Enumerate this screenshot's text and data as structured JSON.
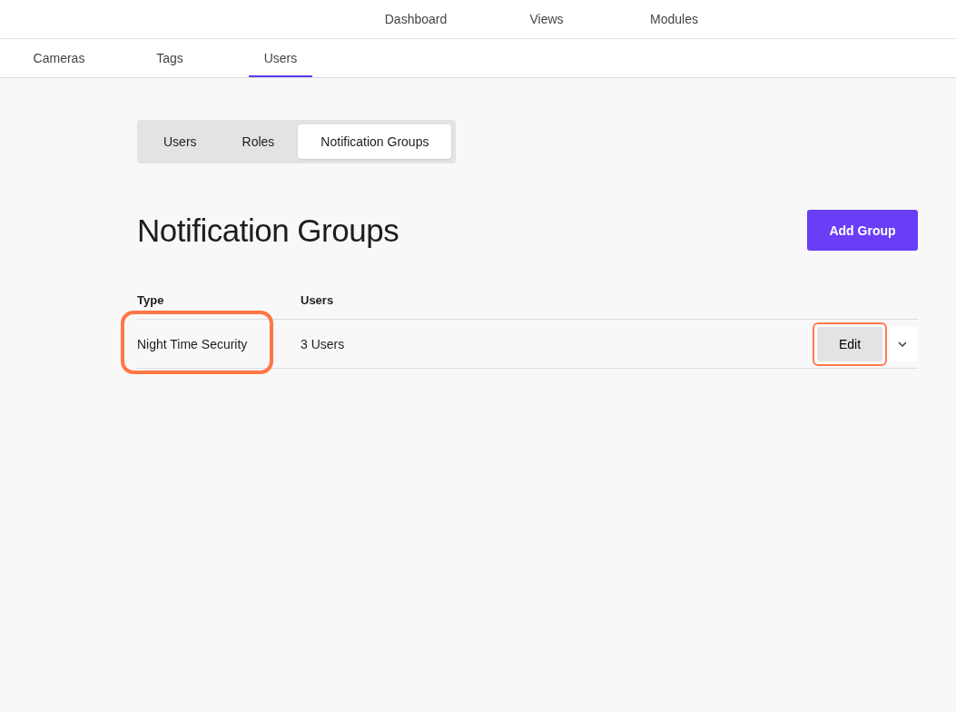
{
  "top_nav": [
    {
      "label": "Dashboard"
    },
    {
      "label": "Views"
    },
    {
      "label": "Modules"
    }
  ],
  "sub_nav": [
    {
      "label": "Cameras",
      "selected": false
    },
    {
      "label": "Tags",
      "selected": false
    },
    {
      "label": "Users",
      "selected": true
    }
  ],
  "segments": [
    {
      "label": "Users",
      "selected": false
    },
    {
      "label": "Roles",
      "selected": false
    },
    {
      "label": "Notification Groups",
      "selected": true
    }
  ],
  "heading": "Notification Groups",
  "add_button": "Add Group",
  "table": {
    "columns": [
      "Type",
      "Users"
    ],
    "rows": [
      {
        "type": "Night Time Security",
        "type_highlighted": true,
        "users": "3 Users",
        "edit": "Edit",
        "edit_highlighted": true
      }
    ]
  }
}
